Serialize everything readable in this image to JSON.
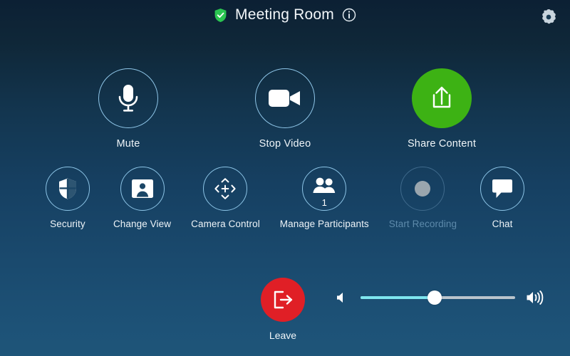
{
  "header": {
    "secure_icon": "shield-check-icon",
    "title": "Meeting Room",
    "info_icon": "info-icon",
    "settings_icon": "gear-icon"
  },
  "colors": {
    "share_green": "#3db214",
    "leave_red": "#e01f26",
    "slider_fill": "#7fe6ee",
    "slider_track": "#b9c4cc",
    "circle_border": "#8cc4e6",
    "disabled_text": "#5d8aab",
    "bg_top": "#0c2034",
    "bg_bottom": "#1e5579"
  },
  "primary_controls": [
    {
      "name": "mute",
      "label": "Mute",
      "icon": "microphone-icon",
      "style": "outline",
      "disabled": false
    },
    {
      "name": "stop-video",
      "label": "Stop Video",
      "icon": "video-camera-icon",
      "style": "outline",
      "disabled": false
    },
    {
      "name": "share-content",
      "label": "Share Content",
      "icon": "share-upload-icon",
      "style": "filled-green",
      "disabled": false
    }
  ],
  "secondary_controls": [
    {
      "name": "security",
      "label": "Security",
      "icon": "shield-icon",
      "disabled": false
    },
    {
      "name": "change-view",
      "label": "Change View",
      "icon": "person-card-icon",
      "disabled": false
    },
    {
      "name": "camera-control",
      "label": "Camera Control",
      "icon": "camera-pan-tilt-icon",
      "disabled": false
    },
    {
      "name": "manage-participants",
      "label": "Manage Participants",
      "icon": "participants-icon",
      "badge": "1",
      "disabled": false
    },
    {
      "name": "start-recording",
      "label": "Start Recording",
      "icon": "record-dot-icon",
      "disabled": true
    },
    {
      "name": "chat",
      "label": "Chat",
      "icon": "chat-bubble-icon",
      "disabled": false
    }
  ],
  "bottom": {
    "leave": {
      "label": "Leave",
      "icon": "exit-arrow-icon"
    },
    "volume": {
      "low_icon": "volume-low-icon",
      "high_icon": "volume-high-icon",
      "value": 48,
      "min": 0,
      "max": 100
    }
  }
}
